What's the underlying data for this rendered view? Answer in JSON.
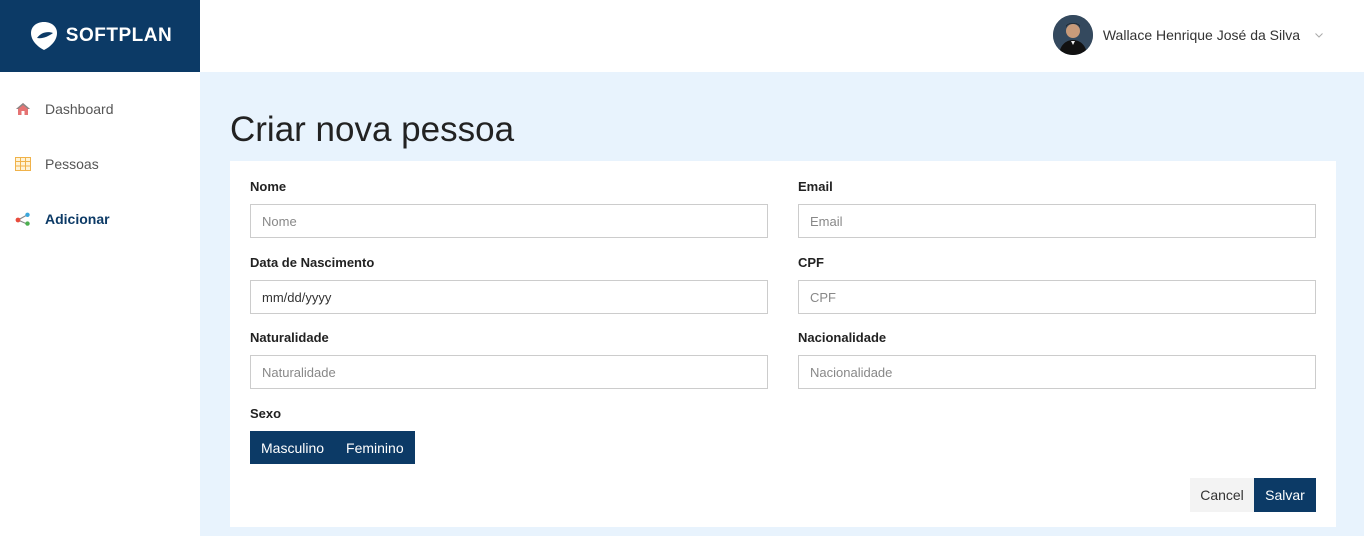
{
  "brand": {
    "logo_text": "SOFTPLAN",
    "color": "#0c3a66"
  },
  "sidebar": {
    "items": [
      {
        "label": "Dashboard",
        "icon": "home-icon",
        "active": false
      },
      {
        "label": "Pessoas",
        "icon": "table-icon",
        "active": false
      },
      {
        "label": "Adicionar",
        "icon": "share-icon",
        "active": true
      }
    ]
  },
  "header": {
    "user_name": "Wallace Henrique José da Silva",
    "user_menu_icon": "chevron-down-icon"
  },
  "main": {
    "title": "Criar nova pessoa",
    "background": "#e8f3fd"
  },
  "form": {
    "nome": {
      "label": "Nome",
      "placeholder": "Nome"
    },
    "email": {
      "label": "Email",
      "placeholder": "Email"
    },
    "data_nascimento": {
      "label": "Data de Nascimento",
      "placeholder": "mm/dd/yyyy"
    },
    "cpf": {
      "label": "CPF",
      "placeholder": "CPF"
    },
    "naturalidade": {
      "label": "Naturalidade",
      "placeholder": "Naturalidade"
    },
    "nacionalidade": {
      "label": "Nacionalidade",
      "placeholder": "Nacionalidade"
    },
    "sexo": {
      "label": "Sexo",
      "options": [
        "Masculino",
        "Feminino"
      ]
    },
    "cancel_label": "Cancel",
    "save_label": "Salvar"
  }
}
